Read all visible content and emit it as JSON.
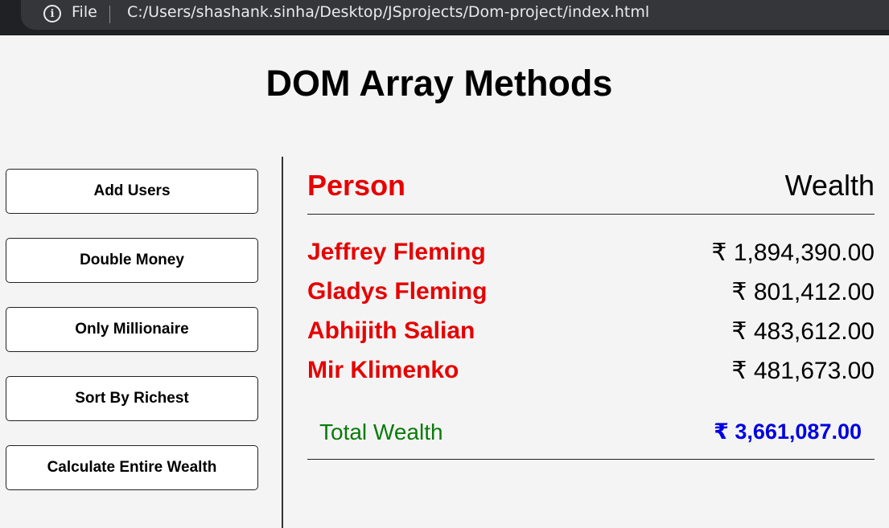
{
  "browser": {
    "info_icon": "info-icon",
    "file_label": "File",
    "url": "C:/Users/shashank.sinha/Desktop/JSprojects/Dom-project/index.html"
  },
  "page": {
    "title": "DOM Array Methods"
  },
  "buttons": {
    "add_users": "Add Users",
    "double_money": "Double Money",
    "only_millionaire": "Only Millionaire",
    "sort_by_richest": "Sort By Richest",
    "calculate_wealth": "Calculate Entire Wealth"
  },
  "table": {
    "header_person": "Person",
    "header_wealth": "Wealth",
    "rows": [
      {
        "name": "Jeffrey Fleming",
        "wealth": "₹ 1,894,390.00"
      },
      {
        "name": "Gladys Fleming",
        "wealth": "₹ 801,412.00"
      },
      {
        "name": "Abhijith Salian",
        "wealth": "₹ 483,612.00"
      },
      {
        "name": "Mir Klimenko",
        "wealth": "₹ 481,673.00"
      }
    ],
    "total_label": "Total Wealth",
    "total_value": "₹ 3,661,087.00"
  },
  "colors": {
    "person_red": "#e60000",
    "total_label_green": "#0a7a0a",
    "total_value_blue": "#0000e0"
  }
}
